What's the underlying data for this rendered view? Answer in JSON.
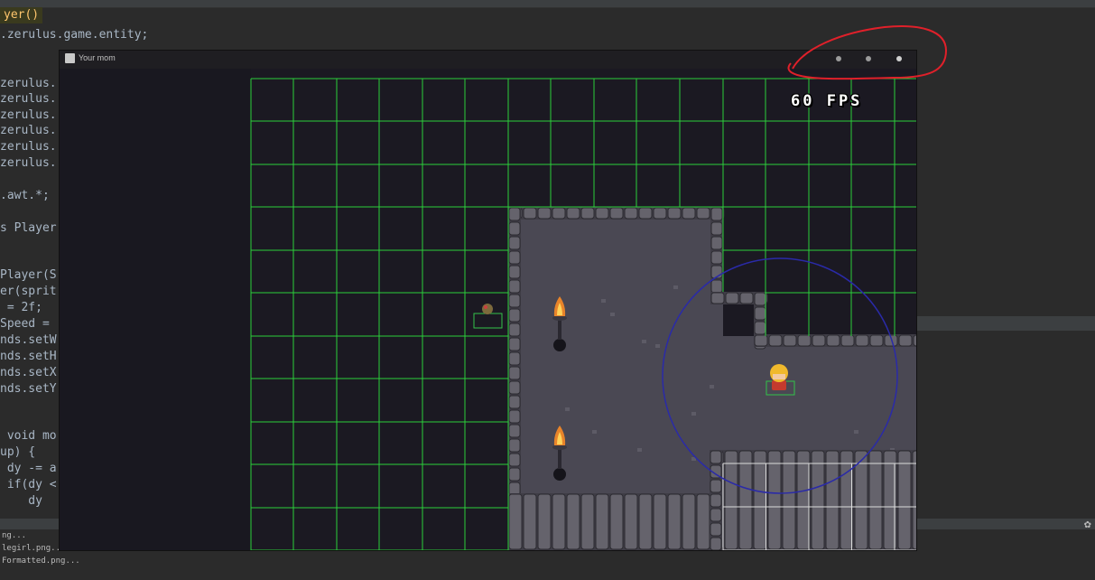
{
  "ide": {
    "code_lines": [
      {
        "text": "yer()",
        "highlight": true
      },
      {
        "text": ".zerulus.game.entity;"
      },
      {
        "text": "zerulus."
      },
      {
        "text": "zerulus."
      },
      {
        "text": "zerulus."
      },
      {
        "text": "zerulus."
      },
      {
        "text": "zerulus."
      },
      {
        "text": "zerulus."
      },
      {
        "text": ".awt.*;"
      },
      {
        "text": "s Player"
      },
      {
        "text": "Player(S"
      },
      {
        "text": "er(sprit"
      },
      {
        "text": " = 2f;"
      },
      {
        "text": "Speed ="
      },
      {
        "text": "nds.setW"
      },
      {
        "text": "nds.setH"
      },
      {
        "text": "nds.setX"
      },
      {
        "text": "nds.setY"
      },
      {
        "text": " void mo"
      },
      {
        "text": "up) {"
      },
      {
        "text": " dy -= a"
      },
      {
        "text": " if(dy <"
      },
      {
        "text": "    dy"
      }
    ],
    "bottom_lines": [
      "ng...",
      "legirl.png...",
      "Formatted.png..."
    ]
  },
  "window": {
    "title": "Your mom"
  },
  "hud": {
    "fps_label": "60 FPS"
  },
  "colors": {
    "grid_line": "#2bd03a",
    "floor": "#4a4853",
    "void": "#1b1922",
    "wall_stone": "#65636c",
    "annotation_red": "#e0202a",
    "range_circle": "#2a2aa8",
    "collision_box": "#33c24a"
  },
  "icons": {
    "window_icon": "java-app-icon",
    "cursor": "mouse-pointer-icon",
    "torch": "torch-icon",
    "player": "player-sprite",
    "enemy": "enemy-sprite"
  }
}
